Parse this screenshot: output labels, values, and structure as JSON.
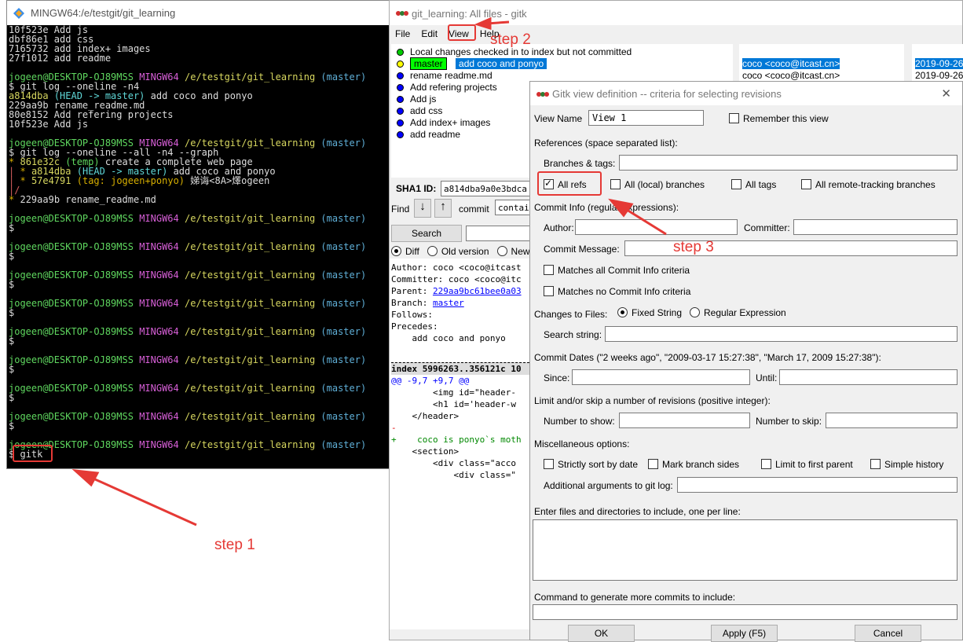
{
  "terminal": {
    "title": "MINGW64:/e/testgit/git_learning",
    "top": [
      "10f523e Add js",
      "dbf86e1 add css",
      "7165732 add index+ images",
      "27f1012 add readme"
    ],
    "user": "jogeen@DESKTOP-OJ89MSS",
    "env": "MINGW64",
    "path": "/e/testgit/git_learning",
    "branch": "(master)",
    "prompt": "$",
    "cmd1": "git log --oneline -n4",
    "log1_h1": "a814dba",
    "log1_ref": "(HEAD -> master)",
    "log1_m1": "add coco and ponyo",
    "log1": [
      "229aa9b rename_readme.md",
      "80e8152 Add refering projects",
      "10f523e Add js"
    ],
    "cmd2": "git log --oneline --all -n4 --graph",
    "g1_hash": "861e32c",
    "g1_ref": "(temp)",
    "g1_msg": "create a complete web page",
    "g2_hash": "a814dba",
    "g2_ref": "(HEAD -> master)",
    "g2_msg": "add coco and ponyo",
    "g3_hash": "57e4791",
    "g3_ref": "(tag: jogeen+ponyo)",
    "g3_msg": "娣诲<8A>燡ogeen",
    "g4": "229aa9b rename_readme.md",
    "last_cmd": "gitk"
  },
  "gitk": {
    "title": "git_learning: All files - gitk",
    "menu": [
      "File",
      "Edit",
      "View",
      "Help"
    ],
    "commits": [
      {
        "msg": "Local changes checked in to index but not committed",
        "color": "#00cc00"
      },
      {
        "branch": "master",
        "msg": "add coco and ponyo",
        "color": "#ffff00"
      },
      {
        "msg": "rename readme.md",
        "color": "#0000ff"
      },
      {
        "msg": "Add refering projects",
        "color": "#0000ff"
      },
      {
        "msg": "Add js",
        "color": "#0000ff"
      },
      {
        "msg": "add css",
        "color": "#0000ff"
      },
      {
        "msg": "Add index+ images",
        "color": "#0000ff"
      },
      {
        "msg": "add readme",
        "color": "#0000ff"
      }
    ],
    "authors": [
      "coco <coco@itcast.cn>",
      "coco <coco@itcast.cn>"
    ],
    "dates": [
      "2019-09-26",
      "2019-09-26"
    ],
    "sha_label": "SHA1 ID:",
    "sha": "a814dba9a0e3bdca",
    "find": "Find",
    "commit": "commit",
    "containing": "contai",
    "search": "Search",
    "diff": "Diff",
    "old": "Old version",
    "new": "New",
    "details": [
      "Author: coco <coco@itcast",
      "Committer: coco <coco@itc",
      "Parent: ",
      "Branch: ",
      "Follows:",
      "Precedes:",
      "",
      "    add coco and ponyo"
    ],
    "parent": "229aa9bc61bee0a03",
    "branchlink": "master",
    "diff_lines": [
      "index 5996263..356121c 10",
      "@@ -9,7 +9,7 @@",
      "        <img id=\"header-",
      "        <h1 id='header-w",
      "    </header>",
      "-",
      "+    coco is ponyo`s moth",
      "    <section>",
      "        <div class=\"acco",
      "            <div class=\""
    ]
  },
  "dialog": {
    "title": "Gitk view definition -- criteria for selecting revisions",
    "view_name_label": "View Name",
    "view_name": "View 1",
    "remember": "Remember this view",
    "refs_label": "References (space separated list):",
    "branches_tags": "Branches & tags:",
    "all_refs": "All refs",
    "local_branches": "All (local) branches",
    "all_tags": "All tags",
    "remote_branches": "All remote-tracking branches",
    "commit_info": "Commit Info (regular expressions):",
    "author": "Author:",
    "committer": "Committer:",
    "commit_message": "Commit Message:",
    "matches_all": "Matches all Commit Info criteria",
    "matches_no": "Matches no Commit Info criteria",
    "changes": "Changes to Files:",
    "fixed": "Fixed String",
    "regex": "Regular Expression",
    "search_string": "Search string:",
    "dates": "Commit Dates (\"2 weeks ago\", \"2009-03-17 15:27:38\", \"March 17, 2009 15:27:38\"):",
    "since": "Since:",
    "until": "Until:",
    "limit": "Limit and/or skip a number of revisions (positive integer):",
    "num_show": "Number to show:",
    "num_skip": "Number to skip:",
    "misc": "Miscellaneous options:",
    "strict": "Strictly sort by date",
    "mark": "Mark branch sides",
    "first_parent": "Limit to first parent",
    "simple": "Simple history",
    "additional": "Additional arguments to git log:",
    "files": "Enter files and directories to include, one per line:",
    "command": "Command to generate more commits to include:",
    "ok": "OK",
    "apply": "Apply (F5)",
    "cancel": "Cancel"
  },
  "annotations": {
    "step1": "step 1",
    "step2": "step 2",
    "step3": "step 3"
  },
  "colors": {
    "accent": "#e53935",
    "selection": "#0078d7"
  }
}
